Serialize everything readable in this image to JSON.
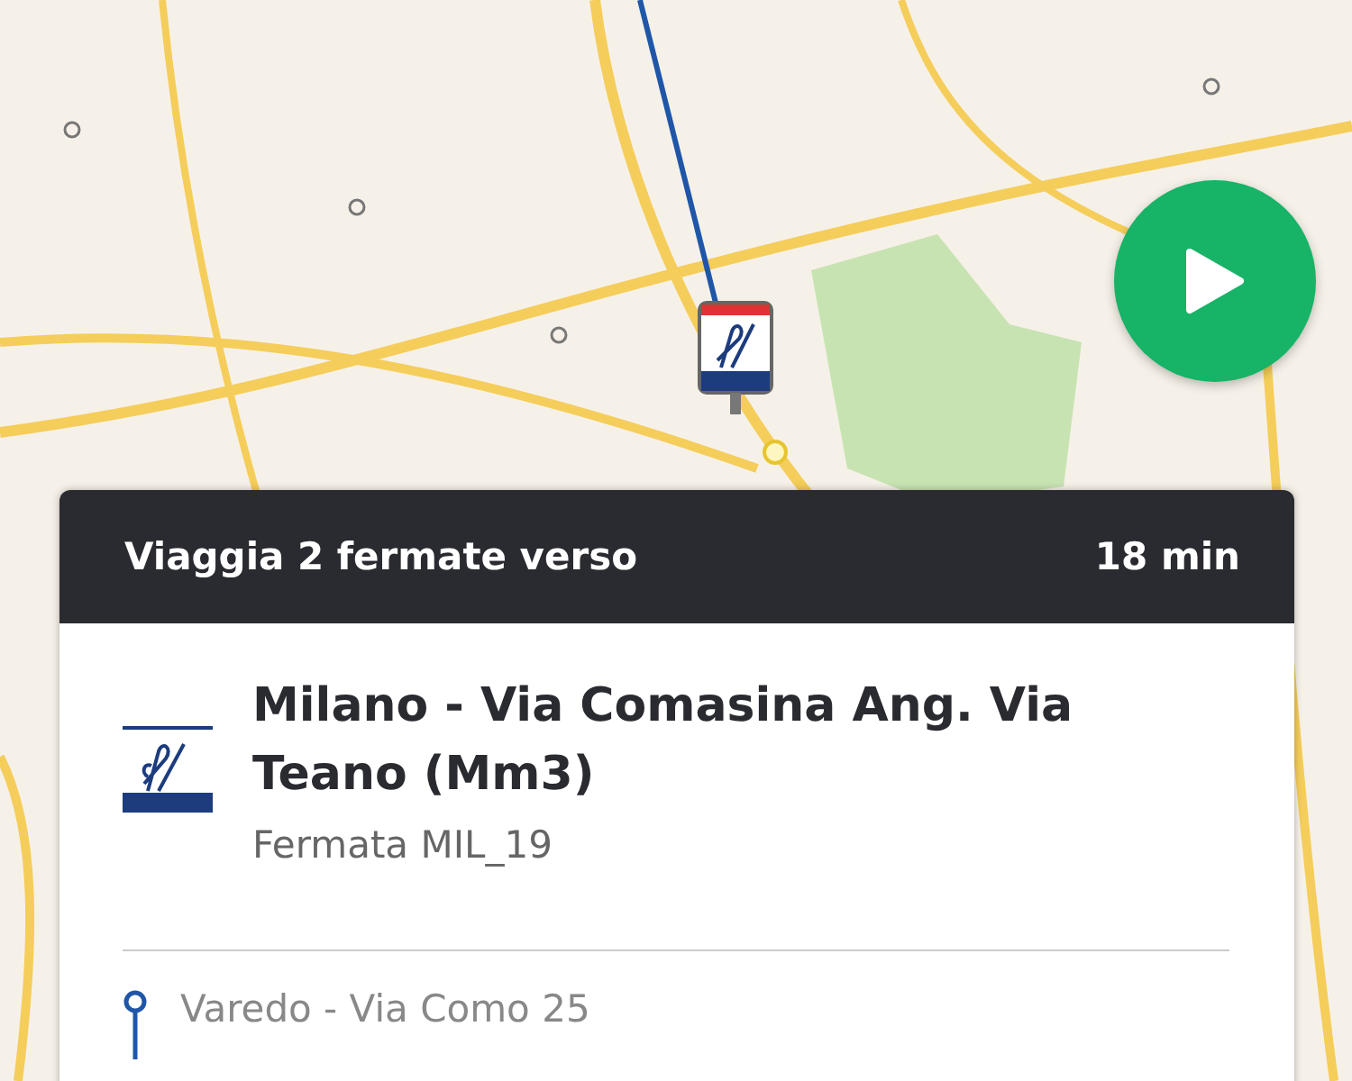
{
  "trip": {
    "heading": "Viaggia 2 fermate verso",
    "duration": "18 min"
  },
  "stop": {
    "name": "Milano - Via Comasina Ang. Via Teano (Mm3)",
    "code": "Fermata MIL_19"
  },
  "next_stops": [
    {
      "name": "Varedo - Via Como 25"
    }
  ]
}
